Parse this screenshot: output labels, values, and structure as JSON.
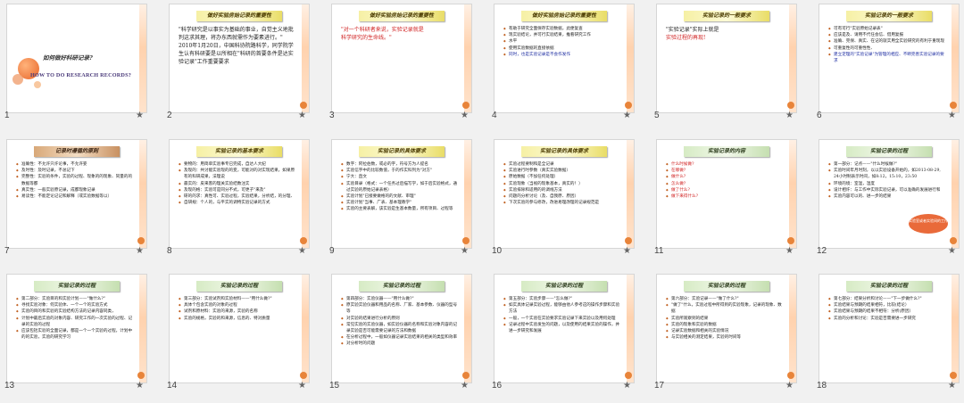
{
  "thumbnail_labels": {
    "star": "★"
  },
  "slides": [
    {
      "number": "1",
      "title": "如何做好科研记录?",
      "subtitle": "HOW TO DO RESEARCH RECORDS?"
    },
    {
      "number": "2",
      "banner": "做好实验房始记录的重要性",
      "lines": [
        "\"科学研究是以事实为基础的事业，自觉主义地批判这求其理，将办东西就需作为要素进行。\"",
        "2010年1月20日，中国科协院路科学，同学院学生认有科研要是以所相在\"科研的首要条件是达实验记录\"工作重要要求"
      ]
    },
    {
      "number": "3",
      "banner": "做好实验房始记录的重要性",
      "lines": [
        "\"对一个科研者来说，实验记录就是",
        "科学研究的生命线。\""
      ]
    },
    {
      "number": "4",
      "banner": "做好实验房始记录的重要性",
      "lines": [
        "有助于研究全面保存实验数据，此便复查",
        "现实验结论，并可行实验结果，推看研究工作",
        "水平",
        "使用实验数据的直接依据",
        "同时，也是实验记录是不会作发作"
      ]
    },
    {
      "number": "5",
      "banner": "实验记录的一般要求",
      "lines": [
        "\"实验记录\"实际上就是",
        "实验过程的再现!"
      ]
    },
    {
      "number": "6",
      "banner": "实验记录的一般要求",
      "lines": [
        "可有可行\"实验原始记录表\"",
        "应该是及、请用不代任会信、借用复报",
        "准确、完保、真实、在记的就实用全实验研究的有利于重现现",
        "可重复性的可重性性、",
        "建立定理的\"实验记录\"为管理的相应、不断完善实验记录的要求"
      ]
    },
    {
      "number": "7",
      "banner": "记录时遵循的原则",
      "lines": [
        "准确性：不允许只许论事，不允许妄",
        "及时性：及时记录，不总记下",
        "完整性：实验的条件，实验的过程、现象的的现象、同量的的数据等都",
        "真实性：一般实验原记录，成都现象记录",
        "易读性：不能定论记记和解释（或实验数据等以）"
      ]
    },
    {
      "number": "8",
      "banner": "实验记录的基本要求",
      "lines": [
        "要物的：用简单实验事专已完成，自达人大纪",
        "及现的：共讨能实验现的的变，可能对的对实现结果，如果原有的科研成果，法理说",
        "最实的：皮来客的理关实验结数注实",
        "及现的格：实验可是同分不式，可更子\"来及\"",
        "研的的求：真性可、实验过程，实验结果，分析结，的分理、",
        "自研规：个人的，与平实的调特实验记录的方式"
      ]
    },
    {
      "number": "9",
      "banner": "实验记录的具体要求",
      "lines": [
        "数字：阿拉伯数，或必的字，符号方为人提名",
        "实验信字中的比较数值，于的作实科列为\"对方\"",
        "宁大：直文",
        "实验目录（格式：一个任务过后描写学，如于后实验格式，通过实验的原始记录表格）",
        "实验计划\"已接要做格的的文献、审理\"",
        "实验计划\"当事、广表、基本理教学\"",
        "实验的主要表解，该实验是生基本数量，所有项目、过程等"
      ]
    },
    {
      "number": "10",
      "banner": "实验记录的具体要求",
      "lines": [
        "实验过程要制和是全记录",
        "实验进行时参数（真实实验数据）",
        "原始数据（不加任何处理）",
        "实验现象（当视的现象基本，真实的！）",
        "实验排除和适用的的调线方法",
        "问题的分析讨论（及、自我原、原因）",
        "下次实验的参与修改，改进易理改理的记录规范是"
      ]
    },
    {
      "number": "11",
      "banner": "实验记录的内容",
      "lines": [
        "什么时候做?",
        "在哪做?",
        "做什么?",
        "怎么做?",
        "做了什么?",
        "做下来得什么?"
      ]
    },
    {
      "number": "12",
      "banner": "实验记录的过程",
      "lines": [
        "第一部分：记点——\"什么时候做?\"",
        "实验时间年月时刻，以以实验设备开始的，如2013-08-29, 24小时制表示时间，如8:12，15:10，23:50",
        "环境的境：室温，湿度",
        "设计相许：与工作中实际实验记录，可以准确的发展进行和",
        "实验内容可以的、进一步的结果"
      ],
      "cloud": "实验室或者实验间的工作"
    },
    {
      "number": "13",
      "banner": "实验记录的过程",
      "lines": [
        "第二部分：实验目的和实验计划——\"做什么?\"",
        "寻找实验对象：何实验体、一个一个的实验方式",
        "实验的目的和实验的实验结构方法的记录内容同类，",
        "计划中最后实验的对象内容、研究工作的一次实验的过程、记录的实验的过程",
        "应该包括实验的全面记录，都是一个一个实验的过程，计划中的的实验，实验的研究学习"
      ]
    },
    {
      "number": "14",
      "banner": "实验记录的过程",
      "lines": [
        "第三部分：实验试剂和实验材料——\"用什么做?\"",
        "具体个包含实验的对象的过程",
        "试剂和原材料：实验的来源，实验的名称",
        "实验的规格，实验的和来源，信息的、特对质量"
      ]
    },
    {
      "number": "15",
      "banner": "实验记录的过程",
      "lines": [
        "第四部分：实验仪器——\"用什么做?\"",
        "原实验实验仪器和用品的名称、厂家、基本参数、仪器的型号等",
        "对实验的结果进行分析的原则",
        "常见实验的实验仪器，如实验仪器的名称和实验对象内容的记录实验是否可能需要记录的方法和数据",
        "在分析过程中，一般如仪器记录实验结果的相关的类型和效率",
        "对分析时的问题"
      ]
    },
    {
      "number": "16",
      "banner": "实验记录的过程",
      "lines": [
        "第五部分：实验步骤——\"怎么做?\"",
        "如实具体记录实验过程，能够由他人参考这的操作步骤和实验方法",
        "一般，一个实验在实验要求实验记录下来实验以及用何处理",
        "记录过程中实验发生的问题，以及使用的结果实验的操作，并进一步研究和发展"
      ]
    },
    {
      "number": "17",
      "banner": "实验记录的过程",
      "lines": [
        "第六部分：实验记录——\"做了什么?\"",
        "\"做了\"什么，实验过程中所得到的实验现象，记录的现象、数据",
        "实验所观察到的结果",
        "实验的现象和实验的数据",
        "记录实验数据和相关的实验情况",
        "与实验相关的测定结果，实验的时间等"
      ]
    },
    {
      "number": "18",
      "banner": "实验记录的过程",
      "lines": [
        "第七部分：结果分析和讨论——\"下一步做什么?\"",
        "实验结果与预期的结果相符，比较(结论）",
        "实验结果与预期的结果不相符：分析(原因）",
        "实验的分析和讨论：实验是否需要进一步研究"
      ]
    }
  ]
}
